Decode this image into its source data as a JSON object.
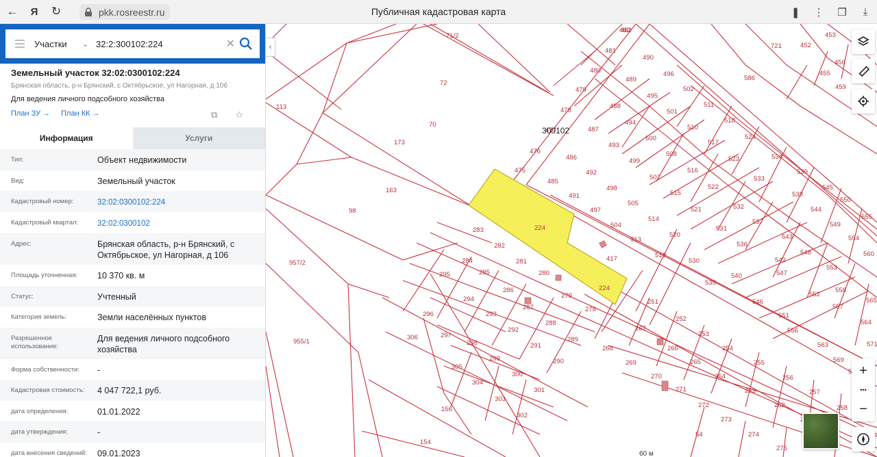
{
  "browser": {
    "url": "pkk.rosreestr.ru",
    "page_title": "Публичная кадастровая карта"
  },
  "search": {
    "type": "Участки",
    "query": "32:2:300102:224"
  },
  "object": {
    "title": "Земельный участок 32:02:0300102:224",
    "address": "Брянская область, р-н Брянский, с Октябрьское, ул Нагорная, д 106",
    "use": "Для ведения личного подсобного хозяйства",
    "link_zu": "План ЗУ →",
    "link_kk": "План КК →"
  },
  "tabs": {
    "info": "Информация",
    "services": "Услуги"
  },
  "info": [
    {
      "key": "Тип:",
      "value": "Объект недвижимости"
    },
    {
      "key": "Вид:",
      "value": "Земельный участок"
    },
    {
      "key": "Кадастровый номер:",
      "value": "32:02:0300102:224"
    },
    {
      "key": "Кадастровый квартал:",
      "value": "32:02:0300102"
    },
    {
      "key": "Адрес:",
      "value": "Брянская область, р-н Брянский, с Октябрьское, ул Нагорная, д 106"
    },
    {
      "key": "Площадь уточненная:",
      "value": "10 370 кв. м"
    },
    {
      "key": "Статус:",
      "value": "Учтенный"
    },
    {
      "key": "Категория земель:",
      "value": "Земли населённых пунктов"
    },
    {
      "key": "Разрешенное использование:",
      "value": "Для ведения личного подсобного хозяйства"
    },
    {
      "key": "Форма собственности:",
      "value": "-"
    },
    {
      "key": "Кадастровая стоимость:",
      "value": "4 047 722,1 руб."
    },
    {
      "key": "дата определения:",
      "value": "01.01.2022"
    },
    {
      "key": "дата утверждения:",
      "value": "-"
    },
    {
      "key": "дата внесения сведений:",
      "value": "09.01.2023"
    }
  ],
  "map": {
    "quarter_label": "300102",
    "selected_parcel_color": "#f5f05a",
    "boundary_color": "#c8323c",
    "scale_label": "60 м",
    "parcel_labels": [
      "482",
      "481",
      "490",
      "496",
      "480",
      "489",
      "495",
      "502",
      "479",
      "488",
      "501",
      "511",
      "478",
      "494",
      "510",
      "518",
      "477",
      "487",
      "500",
      "517",
      "524",
      "476",
      "493",
      "508",
      "523",
      "534",
      "486",
      "499",
      "516",
      "533",
      "539",
      "475",
      "492",
      "507",
      "522",
      "485",
      "491",
      "498",
      "515",
      "532",
      "538",
      "545",
      "497",
      "505",
      "521",
      "537",
      "544",
      "550",
      "504",
      "514",
      "531",
      "543",
      "549",
      "555",
      "513",
      "520",
      "536",
      "548",
      "554",
      "561",
      "417",
      "519",
      "530",
      "542",
      "553",
      "560",
      "535",
      "547",
      "558",
      "540",
      "552",
      "557",
      "565",
      "546",
      "564",
      "551",
      "556",
      "563",
      "571",
      "569",
      "570",
      "251",
      "252",
      "253",
      "254",
      "255",
      "256",
      "257",
      "258",
      "267",
      "266",
      "265",
      "264",
      "263",
      "262",
      "261",
      "268",
      "269",
      "270",
      "271",
      "272",
      "273",
      "274",
      "275",
      "54",
      "283",
      "282",
      "284",
      "281",
      "280",
      "279",
      "278",
      "285",
      "286",
      "295",
      "294",
      "293",
      "292",
      "291",
      "290",
      "289",
      "288",
      "287",
      "296",
      "297",
      "298",
      "299",
      "300",
      "301",
      "302",
      "303",
      "304",
      "305",
      "306",
      "113",
      "72",
      "70",
      "71/2",
      "173",
      "163",
      "98",
      "957/2",
      "955/1",
      "156",
      "154",
      "721",
      "586",
      "452",
      "453",
      "456",
      "455",
      "459",
      "224",
      "462"
    ]
  },
  "controls": {
    "zoom_in": "+",
    "more": "•••",
    "zoom_out": "−"
  }
}
